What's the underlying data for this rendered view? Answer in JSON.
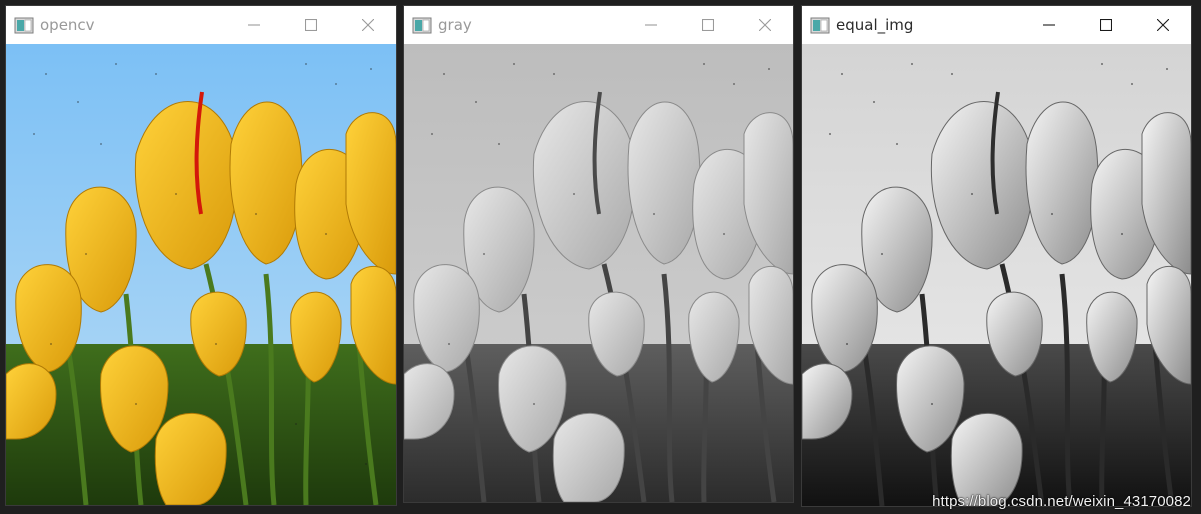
{
  "windows": [
    {
      "title": "opencv",
      "active": false
    },
    {
      "title": "gray",
      "active": false
    },
    {
      "title": "equal_img",
      "active": true
    }
  ],
  "watermark": "https://blog.csdn.net/weixin_43170082",
  "colors": {
    "sky": "#6ab4f0",
    "petal": "#f2b81a",
    "petal_dark": "#c98a08",
    "stem": "#3e6b1e",
    "gray_bg": "#d8d8d8",
    "equal_bg": "#e6e6e6"
  }
}
